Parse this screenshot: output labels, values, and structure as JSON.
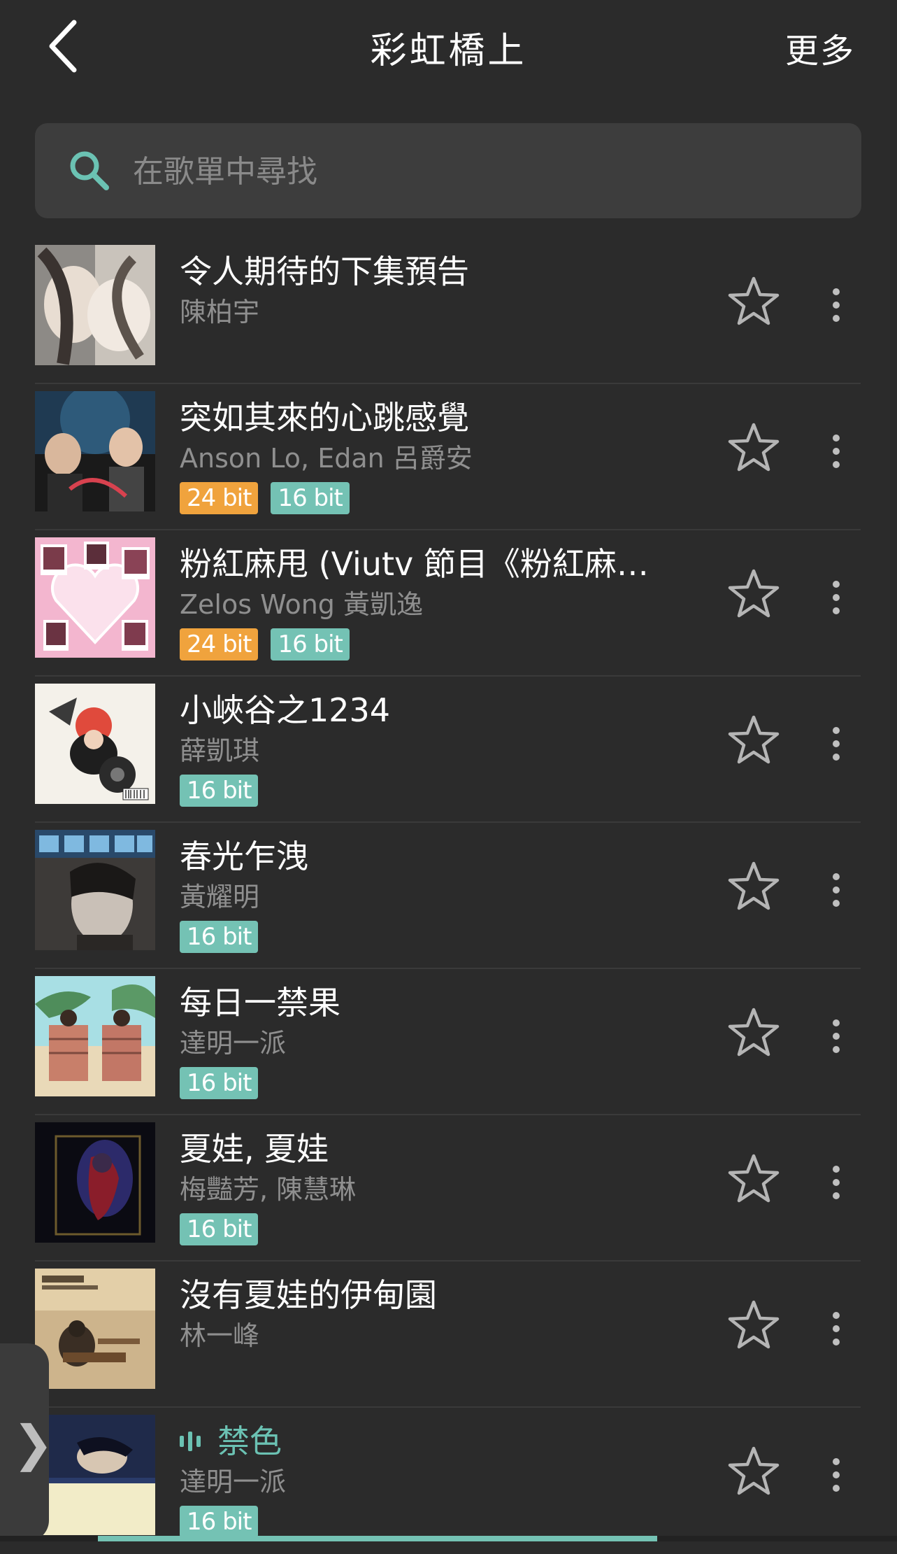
{
  "header": {
    "title": "彩虹橋上",
    "more_label": "更多"
  },
  "search": {
    "placeholder": "在歌單中尋找"
  },
  "colors": {
    "accent": "#6bc2b3",
    "badge_24": "#f0a33d",
    "badge_16": "#74c2b4"
  },
  "songs": [
    {
      "title": "令人期待的下集預告",
      "artist": "陳柏宇",
      "badges": []
    },
    {
      "title": "突如其來的心跳感覺",
      "artist": "Anson Lo, Edan 呂爵安",
      "badges": [
        "24 bit",
        "16 bit"
      ]
    },
    {
      "title": "粉紅麻甩 (Viutv 節目《粉紅麻…",
      "artist": "Zelos Wong 黃凱逸",
      "badges": [
        "24 bit",
        "16 bit"
      ]
    },
    {
      "title": "小峽谷之1234",
      "artist": "薛凱琪",
      "badges": [
        "16 bit"
      ]
    },
    {
      "title": "春光乍洩",
      "artist": "黃耀明",
      "badges": [
        "16 bit"
      ]
    },
    {
      "title": "每日一禁果",
      "artist": "達明一派",
      "badges": [
        "16 bit"
      ]
    },
    {
      "title": "夏娃, 夏娃",
      "artist": "梅豔芳, 陳慧琳",
      "badges": [
        "16 bit"
      ]
    },
    {
      "title": "沒有夏娃的伊甸園",
      "artist": "林一峰",
      "badges": []
    },
    {
      "title": "禁色",
      "artist": "達明一派",
      "badges": [
        "16 bit"
      ],
      "playing": true
    }
  ]
}
